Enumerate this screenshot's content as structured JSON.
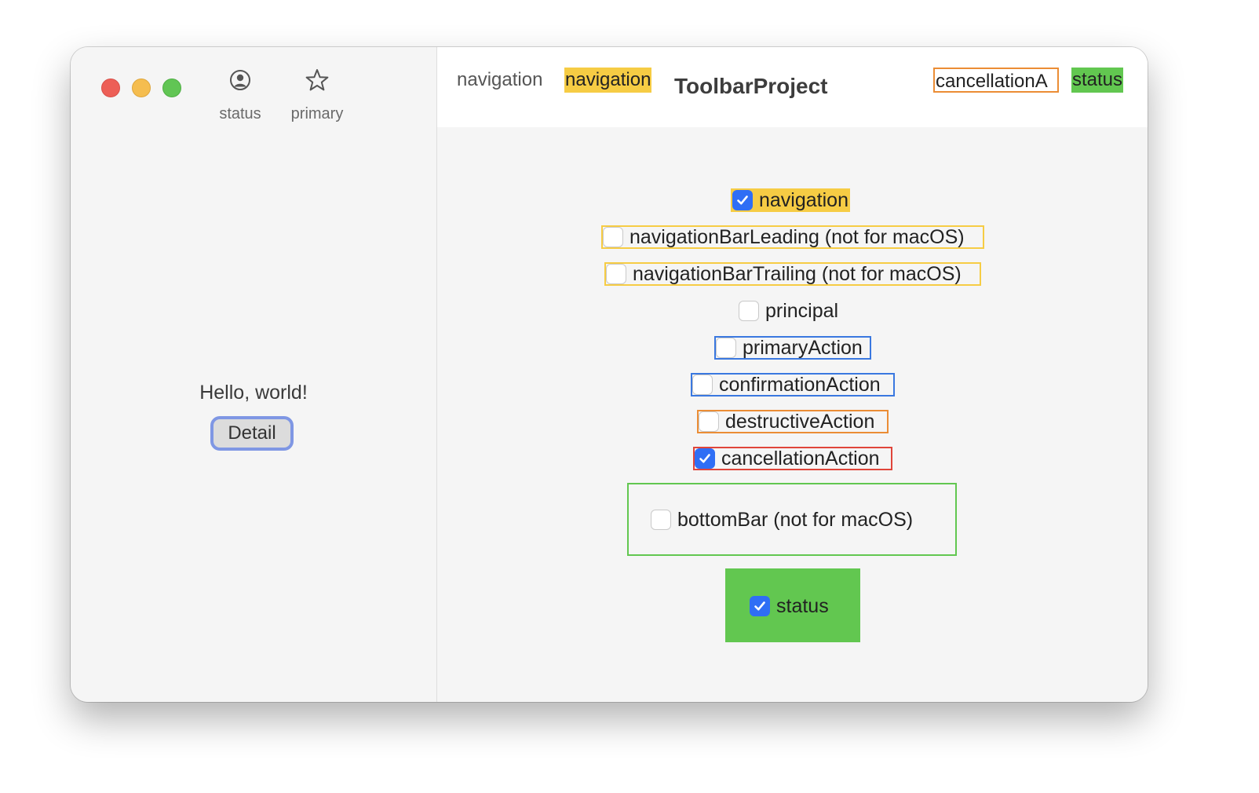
{
  "window": {
    "traffic_lights": [
      "close",
      "minimize",
      "zoom"
    ]
  },
  "sidebar": {
    "toolbar": {
      "status_label": "status",
      "status_icon": "person-circle-icon",
      "primary_label": "primary",
      "primary_icon": "star-icon"
    },
    "greeting": "Hello, world!",
    "detail_button": "Detail"
  },
  "main": {
    "toolbar": {
      "navigation_plain": "navigation",
      "navigation_highlighted": "navigation",
      "title": "ToolbarProject",
      "cancellation_truncated": "cancellationA",
      "status": "status"
    },
    "options": [
      {
        "label": "navigation",
        "checked": true
      },
      {
        "label": "navigationBarLeading (not for macOS)",
        "checked": false
      },
      {
        "label": "navigationBarTrailing (not for macOS)",
        "checked": false
      },
      {
        "label": "principal",
        "checked": false
      },
      {
        "label": "primaryAction",
        "checked": false
      },
      {
        "label": "confirmationAction",
        "checked": false
      },
      {
        "label": "destructiveAction",
        "checked": false
      },
      {
        "label": "cancellationAction",
        "checked": true
      },
      {
        "label": "bottomBar (not for macOS)",
        "checked": false
      },
      {
        "label": "status",
        "checked": true
      }
    ]
  },
  "colors": {
    "yellow": "#f6cc44",
    "blue": "#3a78e0",
    "orange": "#eb8d35",
    "red": "#e0453a",
    "green": "#62c750",
    "checkbox_checked": "#2f6ef5"
  }
}
